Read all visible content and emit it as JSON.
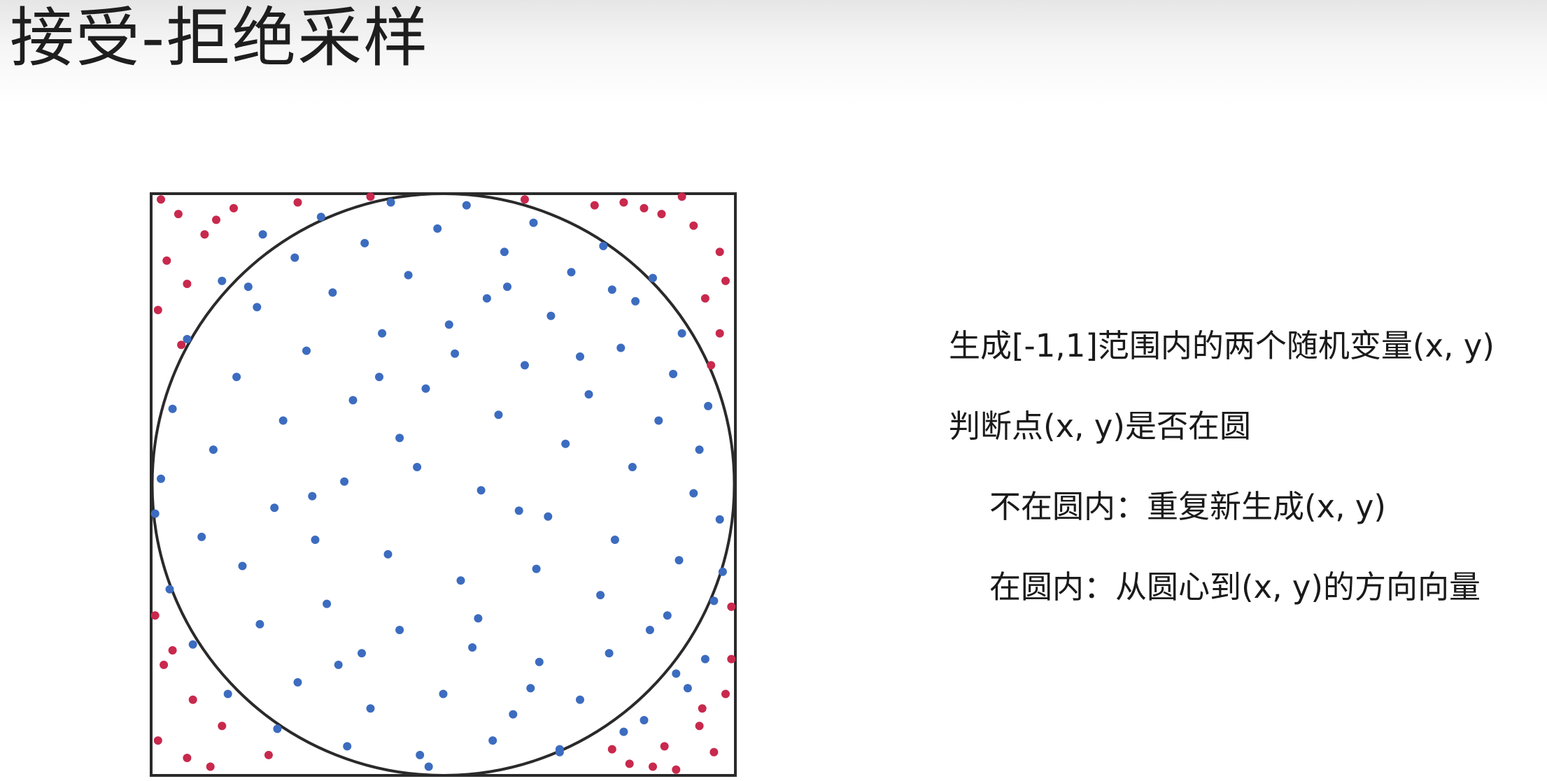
{
  "slide": {
    "title": "接受-拒绝采样"
  },
  "steps": [
    "生成[-1,1]范围内的两个随机变量(x, y)",
    "判断点(x, y)是否在圆",
    "不在圆内：重复新生成(x, y)",
    "在圆内：从圆心到(x, y)的方向向量"
  ],
  "colors": {
    "accepted": "#3c6cc0",
    "rejected": "#c8294d",
    "outline": "#2a2a2a"
  },
  "chart_data": {
    "type": "scatter",
    "title": "",
    "xlabel": "",
    "ylabel": "",
    "xlim": [
      -1,
      1
    ],
    "ylim": [
      -1,
      1
    ],
    "grid": false,
    "shapes": [
      "square",
      "circle"
    ],
    "series": [
      {
        "key": "accepted",
        "x": [
          -0.62,
          -0.42,
          -0.18,
          0.08,
          0.31,
          0.55,
          0.72,
          -0.76,
          -0.51,
          -0.27,
          -0.02,
          0.21,
          0.44,
          0.66,
          0.82,
          -0.88,
          -0.64,
          -0.38,
          -0.12,
          0.15,
          0.37,
          0.61,
          0.79,
          0.91,
          -0.93,
          -0.71,
          -0.47,
          -0.21,
          0.04,
          0.28,
          0.5,
          0.74,
          0.88,
          -0.97,
          -0.79,
          -0.55,
          -0.31,
          -0.06,
          0.19,
          0.42,
          0.65,
          0.86,
          0.95,
          -0.99,
          -0.83,
          -0.58,
          -0.34,
          -0.09,
          0.13,
          0.36,
          0.59,
          0.81,
          0.96,
          -0.94,
          -0.69,
          -0.44,
          -0.19,
          0.06,
          0.32,
          0.54,
          0.77,
          0.93,
          -0.86,
          -0.63,
          -0.4,
          -0.15,
          0.1,
          0.33,
          0.57,
          0.8,
          0.9,
          -0.74,
          -0.5,
          -0.25,
          0.0,
          0.24,
          0.47,
          0.69,
          0.84,
          -0.57,
          -0.33,
          -0.08,
          0.17,
          0.4,
          0.62,
          -0.28,
          0.02,
          0.3,
          -0.45,
          0.47,
          0.12,
          -0.15,
          0.22,
          -0.36,
          0.58,
          0.71,
          -0.67,
          0.4,
          -0.05,
          -0.22,
          0.26
        ],
        "y": [
          0.86,
          0.92,
          0.97,
          0.96,
          0.9,
          0.82,
          0.71,
          0.7,
          0.78,
          0.83,
          0.88,
          0.8,
          0.73,
          0.63,
          0.52,
          0.5,
          0.61,
          0.66,
          0.72,
          0.64,
          0.58,
          0.47,
          0.38,
          0.27,
          0.26,
          0.37,
          0.46,
          0.52,
          0.45,
          0.41,
          0.31,
          0.22,
          0.12,
          0.02,
          0.12,
          0.22,
          0.29,
          0.33,
          0.24,
          0.14,
          0.06,
          -0.03,
          -0.12,
          -0.1,
          -0.18,
          -0.08,
          0.01,
          0.06,
          -0.02,
          -0.11,
          -0.19,
          -0.26,
          -0.3,
          -0.36,
          -0.28,
          -0.19,
          -0.24,
          -0.33,
          -0.29,
          -0.38,
          -0.45,
          -0.4,
          -0.55,
          -0.48,
          -0.41,
          -0.5,
          -0.56,
          -0.61,
          -0.58,
          -0.65,
          -0.6,
          -0.72,
          -0.68,
          -0.77,
          -0.72,
          -0.79,
          -0.74,
          -0.81,
          -0.7,
          -0.84,
          -0.9,
          -0.93,
          -0.88,
          -0.91,
          -0.85,
          -0.58,
          0.55,
          -0.7,
          -0.04,
          0.44,
          -0.46,
          0.16,
          0.68,
          -0.62,
          0.67,
          -0.5,
          0.68,
          -0.92,
          -0.97,
          0.37,
          -0.09
        ]
      },
      {
        "key": "rejected",
        "x": [
          -0.97,
          -0.91,
          -0.82,
          -0.95,
          -0.88,
          -0.78,
          -0.98,
          -0.9,
          0.62,
          0.75,
          0.86,
          0.95,
          0.97,
          0.82,
          0.69,
          0.9,
          -0.96,
          -0.86,
          -0.76,
          -0.98,
          -0.88,
          -0.8,
          -0.93,
          0.64,
          0.76,
          0.88,
          0.97,
          0.99,
          0.8,
          0.93,
          -0.5,
          -0.25,
          0.28,
          0.52,
          0.95,
          -0.6,
          0.58,
          0.99,
          -0.99,
          0.72,
          -0.72,
          0.89,
          0.92
        ],
        "y": [
          0.98,
          0.93,
          0.86,
          0.77,
          0.69,
          0.91,
          0.6,
          0.48,
          0.97,
          0.93,
          0.89,
          0.8,
          0.7,
          0.99,
          0.95,
          0.64,
          -0.62,
          -0.74,
          -0.83,
          -0.88,
          -0.94,
          -0.97,
          -0.57,
          -0.96,
          -0.9,
          -0.83,
          -0.72,
          -0.6,
          -0.98,
          -0.92,
          0.97,
          0.99,
          0.98,
          0.96,
          0.52,
          -0.93,
          -0.91,
          -0.42,
          -0.45,
          -0.97,
          0.95,
          -0.77,
          0.41
        ]
      }
    ]
  }
}
